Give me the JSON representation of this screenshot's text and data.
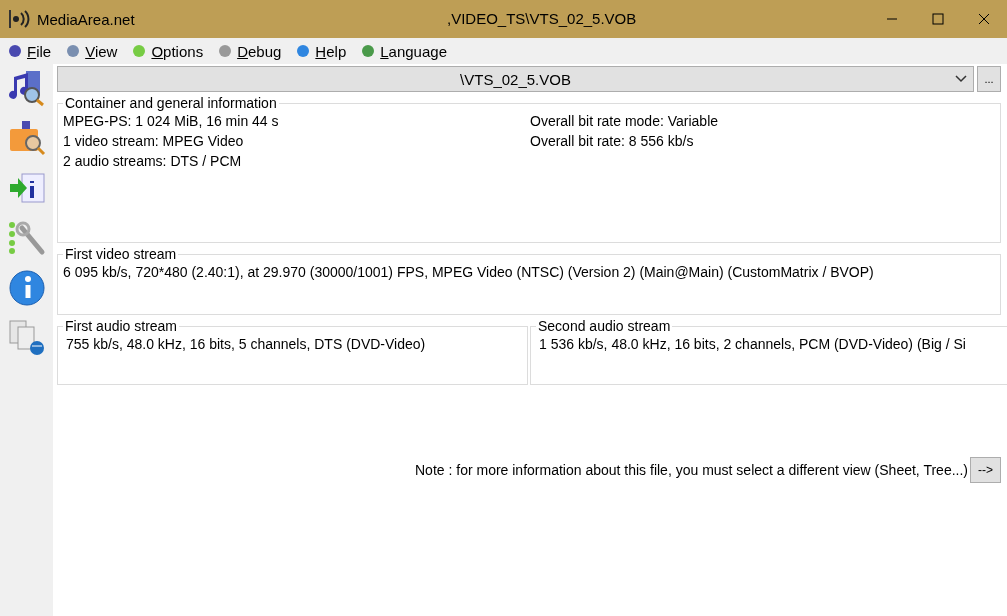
{
  "window": {
    "app_name": "MediaArea.net",
    "title": ",VIDEO_TS\\VTS_02_5.VOB"
  },
  "menu": [
    {
      "label": "File"
    },
    {
      "label": "View"
    },
    {
      "label": "Options"
    },
    {
      "label": "Debug"
    },
    {
      "label": "Help"
    },
    {
      "label": "Language"
    }
  ],
  "file_selector": {
    "value": "\\VTS_02_5.VOB",
    "browse_label": "..."
  },
  "sections": [
    {
      "title": "Container and general information",
      "columns": [
        [
          "MPEG-PS: 1 024 MiB, 16 min 44 s",
          "1 video stream: MPEG Video",
          "2 audio streams: DTS / PCM"
        ],
        [
          "Overall bit rate mode: Variable",
          "Overall bit rate: 8 556 kb/s"
        ]
      ]
    },
    {
      "title": "First video stream",
      "columns": [
        [
          "6 095 kb/s, 720*480 (2.40:1), at 29.970 (30000/1001) FPS, MPEG Video (NTSC) (Version 2) (Main@Main) (CustomMatrix / BVOP)"
        ]
      ]
    }
  ],
  "audio_sections": [
    {
      "title": "First audio stream",
      "text": "755 kb/s, 48.0 kHz, 16 bits, 5 channels, DTS (DVD-Video)"
    },
    {
      "title": "Second audio stream",
      "text": "1 536 kb/s, 48.0 kHz, 16 bits, 2 channels, PCM (DVD-Video) (Big / Si"
    }
  ],
  "note": {
    "text": "Note : for more information about this file, you must select a different view (Sheet, Tree...)",
    "button": "-->"
  }
}
